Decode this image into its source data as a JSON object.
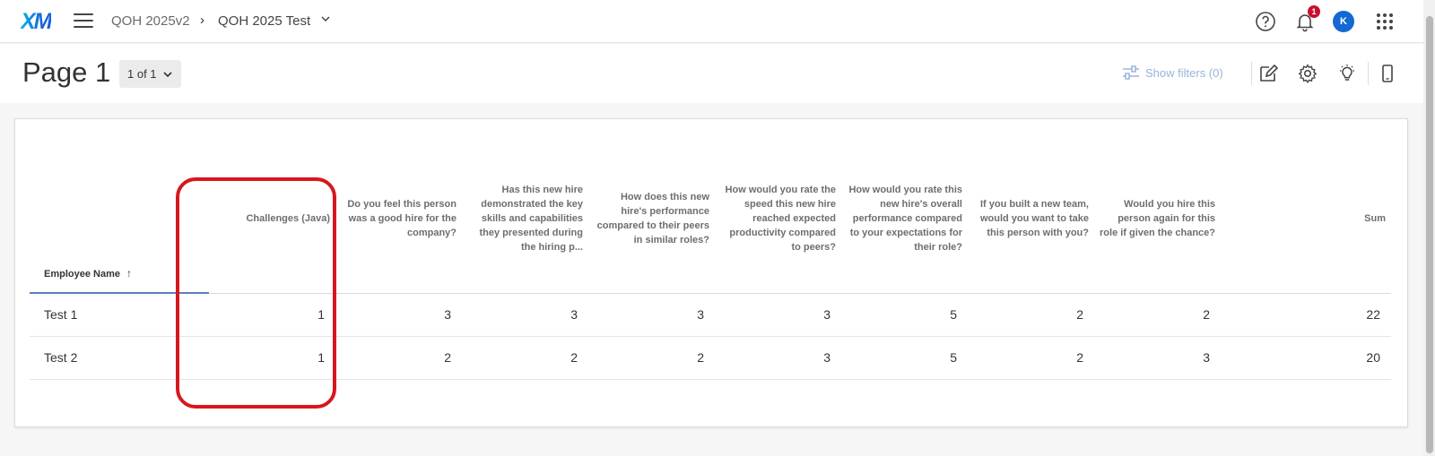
{
  "topbar": {
    "logo": "XM",
    "breadcrumb_project": "QOH 2025v2",
    "breadcrumb_separator": "›",
    "breadcrumb_dashboard": "QOH 2025 Test",
    "notification_count": "1",
    "avatar_initial": "K",
    "icons": [
      "menu-icon",
      "chevron-down-icon",
      "help-icon",
      "bell-icon",
      "apps-grid-icon"
    ]
  },
  "pagebar": {
    "title": "Page 1",
    "page_selector": "1 of 1",
    "show_filters": "Show filters (0)",
    "icons": [
      "filter-icon",
      "edit-icon",
      "gear-icon",
      "lightbulb-icon",
      "mobile-icon"
    ]
  },
  "table": {
    "columns": [
      "Employee Name",
      "Challenges (Java)",
      "Do you feel this person was a good hire for the company?",
      "Has this new hire demonstrated the key skills and capabilities they presented during the hiring p...",
      "How does this new hire's performance compared to their peers in similar roles?",
      "How would you rate the speed this new hire reached expected productivity compared to peers?",
      "How would you rate this new hire's overall performance compared to your expectations for their role?",
      "If you built a new team, would you want to take this person with you?",
      "Would you hire this person again for this role if given the chance?",
      "Sum"
    ],
    "sort_indicator": "↑",
    "rows": [
      [
        "Test 1",
        "1",
        "3",
        "3",
        "3",
        "3",
        "5",
        "2",
        "2",
        "22"
      ],
      [
        "Test 2",
        "1",
        "2",
        "2",
        "2",
        "3",
        "5",
        "2",
        "3",
        "20"
      ]
    ]
  },
  "colors": {
    "highlight": "#d8161e",
    "accent": "#1468d4",
    "badge": "#c8102e"
  }
}
